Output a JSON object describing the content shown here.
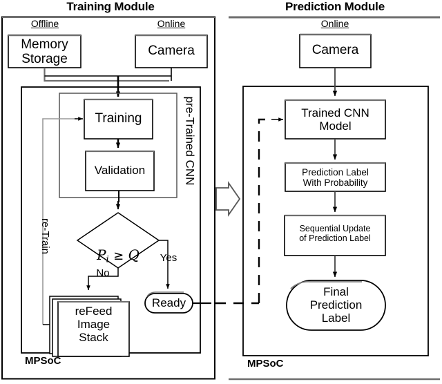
{
  "figure": {
    "type": "flowchart",
    "modules": [
      {
        "id": "training",
        "title": "Training Module",
        "chip_label": "MPSoC",
        "lanes": [
          {
            "id": "offline",
            "label": "Offline"
          },
          {
            "id": "online",
            "label": "Online"
          }
        ],
        "nodes": [
          {
            "id": "memory-storage",
            "label": "Memory\nStorage",
            "shape": "rect"
          },
          {
            "id": "camera",
            "label": "Camera",
            "shape": "rect"
          },
          {
            "id": "pretrained-cnn-group",
            "label": "pre-Trained CNN",
            "shape": "group-rect",
            "orientation": "vertical"
          },
          {
            "id": "training",
            "label": "Training",
            "shape": "rect"
          },
          {
            "id": "validation",
            "label": "Validation",
            "shape": "rect"
          },
          {
            "id": "decision",
            "label": "Pi ≥ Q",
            "shape": "diamond"
          },
          {
            "id": "refeed-image-stack",
            "label": "reFeed\nImage\nStack",
            "shape": "stacked-rect"
          },
          {
            "id": "ready",
            "label": "Ready",
            "shape": "stadium"
          }
        ],
        "edge_labels": [
          {
            "id": "re-train",
            "label": "re-Train",
            "orientation": "vertical"
          },
          {
            "id": "yes",
            "label": "Yes"
          },
          {
            "id": "no",
            "label": "No"
          }
        ]
      },
      {
        "id": "prediction",
        "title": "Prediction Module",
        "chip_label": "MPSoC",
        "lanes": [
          {
            "id": "online",
            "label": "Online"
          }
        ],
        "nodes": [
          {
            "id": "camera",
            "label": "Camera",
            "shape": "rect"
          },
          {
            "id": "trained-cnn-model",
            "label": "Trained CNN\nModel",
            "shape": "rect"
          },
          {
            "id": "prediction-label-with-probability",
            "label": "Prediction Label\nWith Probability",
            "shape": "rect"
          },
          {
            "id": "sequential-update",
            "label": "Sequential Update\nof Prediction Label",
            "shape": "rect"
          },
          {
            "id": "final-prediction-label",
            "label": "Final\nPrediction\nLabel",
            "shape": "stadium"
          }
        ]
      }
    ],
    "connector": {
      "id": "module-transfer-arrow",
      "style": "hollow-block-arrow",
      "direction": "right"
    },
    "colors": {
      "stroke": "#000000",
      "accent_gray": "#6e6e6e",
      "background": "#ffffff"
    }
  }
}
